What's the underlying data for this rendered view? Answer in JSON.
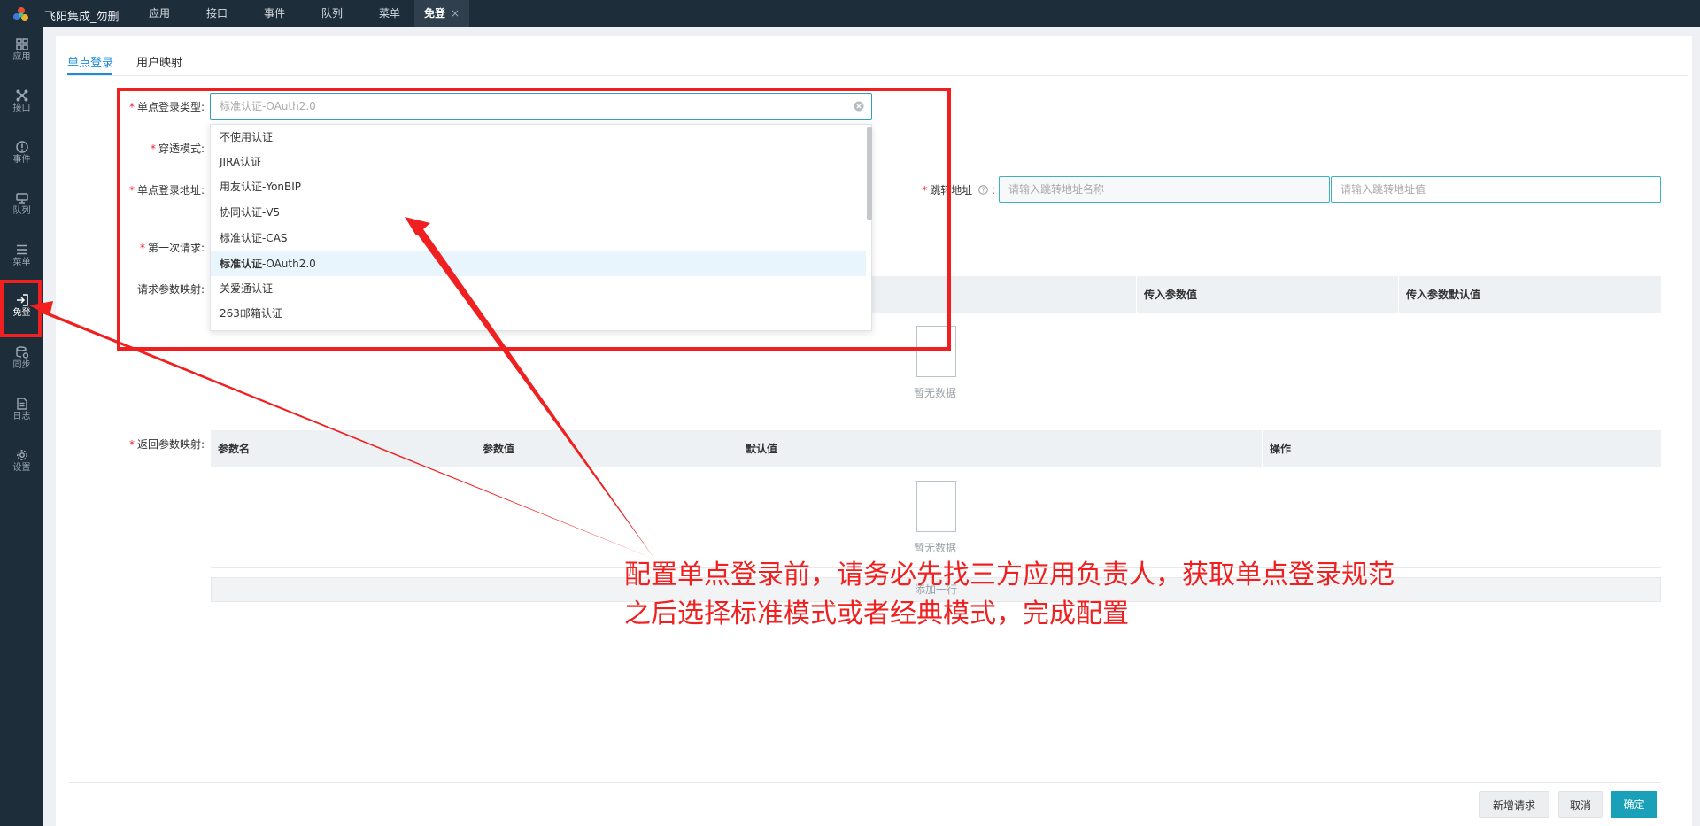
{
  "app_title": "飞阳集成_勿删",
  "topnav": [
    {
      "label": "应用"
    },
    {
      "label": "接口"
    },
    {
      "label": "事件"
    },
    {
      "label": "队列"
    },
    {
      "label": "菜单"
    },
    {
      "label": "免登",
      "close": "×"
    }
  ],
  "sidebar": [
    {
      "label": "应用",
      "icon": "grid-icon"
    },
    {
      "label": "接口",
      "icon": "network-icon"
    },
    {
      "label": "事件",
      "icon": "alert-icon"
    },
    {
      "label": "队列",
      "icon": "queue-icon"
    },
    {
      "label": "菜单",
      "icon": "menu-icon"
    },
    {
      "label": "免登",
      "icon": "login-icon"
    },
    {
      "label": "同步",
      "icon": "sync-icon"
    },
    {
      "label": "日志",
      "icon": "log-icon"
    },
    {
      "label": "设置",
      "icon": "gear-icon"
    }
  ],
  "tabs": [
    {
      "label": "单点登录"
    },
    {
      "label": "用户映射"
    }
  ],
  "form": {
    "sso_type_label": "单点登录类型:",
    "sso_type_placeholder": "标准认证-OAuth2.0",
    "penetrate_label": "穿透模式:",
    "sso_url_label": "单点登录地址:",
    "redirect_label": "跳转地址",
    "redirect_name_placeholder": "请输入跳转地址名称",
    "redirect_value_placeholder": "请输入跳转地址值",
    "first_request_label": "第一次请求:",
    "request_mapping_label": "请求参数映射:",
    "return_mapping_label": "返回参数映射:"
  },
  "dropdown": {
    "options": [
      {
        "label": "不使用认证"
      },
      {
        "label": "JIRA认证"
      },
      {
        "label": "用友认证-YonBIP"
      },
      {
        "label": "协同认证-V5"
      },
      {
        "label": "标准认证-CAS"
      },
      {
        "label_bold": "标准认证",
        "label_rest": "-OAuth2.0"
      },
      {
        "label": "关爱通认证"
      },
      {
        "label": "263邮箱认证"
      }
    ]
  },
  "request_table": {
    "columns": [
      "传入参数值",
      "传入参数默认值"
    ],
    "empty_text": "暂无数据"
  },
  "return_table": {
    "columns": [
      "参数名",
      "参数值",
      "默认值",
      "操作"
    ],
    "empty_text": "暂无数据"
  },
  "add_row_label": "添加一行",
  "footer": {
    "add_request": "新增请求",
    "cancel": "取消",
    "confirm": "确定"
  },
  "annotation": {
    "line1": "配置单点登录前，请务必先找三方应用负责人，获取单点登录规范",
    "line2": "之后选择标准模式或者经典模式，完成配置"
  },
  "colors": {
    "accent": "#1f8dd6",
    "primary_button": "#1aa0b8",
    "annotation_red": "#f02020",
    "dark_nav": "#1e2d3a"
  }
}
